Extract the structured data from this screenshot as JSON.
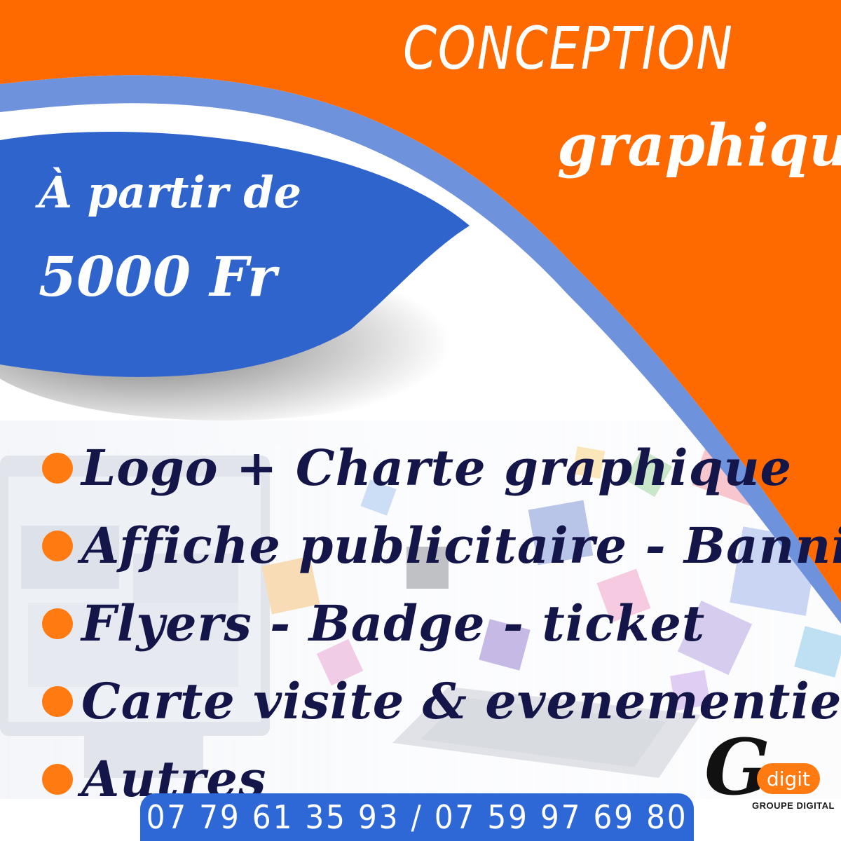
{
  "colors": {
    "orange": "#ff6a00",
    "blue": "#2f64cc",
    "navy_text": "#141548",
    "bullet": "#ff7a10",
    "phone_bar": "#2e67d6"
  },
  "headline": {
    "line1": "CONCEPTION",
    "line2": "graphique"
  },
  "price": {
    "line1": "À partir de",
    "line2": "5000 Fr"
  },
  "services": [
    "Logo + Charte graphique",
    "Affiche publicitaire - Bannière",
    "Flyers - Badge - ticket",
    "Carte visite & evenementielle",
    "Autres"
  ],
  "phone": "07 79 61 35 93  / 07 59 97 69 80",
  "logo": {
    "letter": "G",
    "name": "digit",
    "tagline": "GROUPE DIGITAL"
  }
}
